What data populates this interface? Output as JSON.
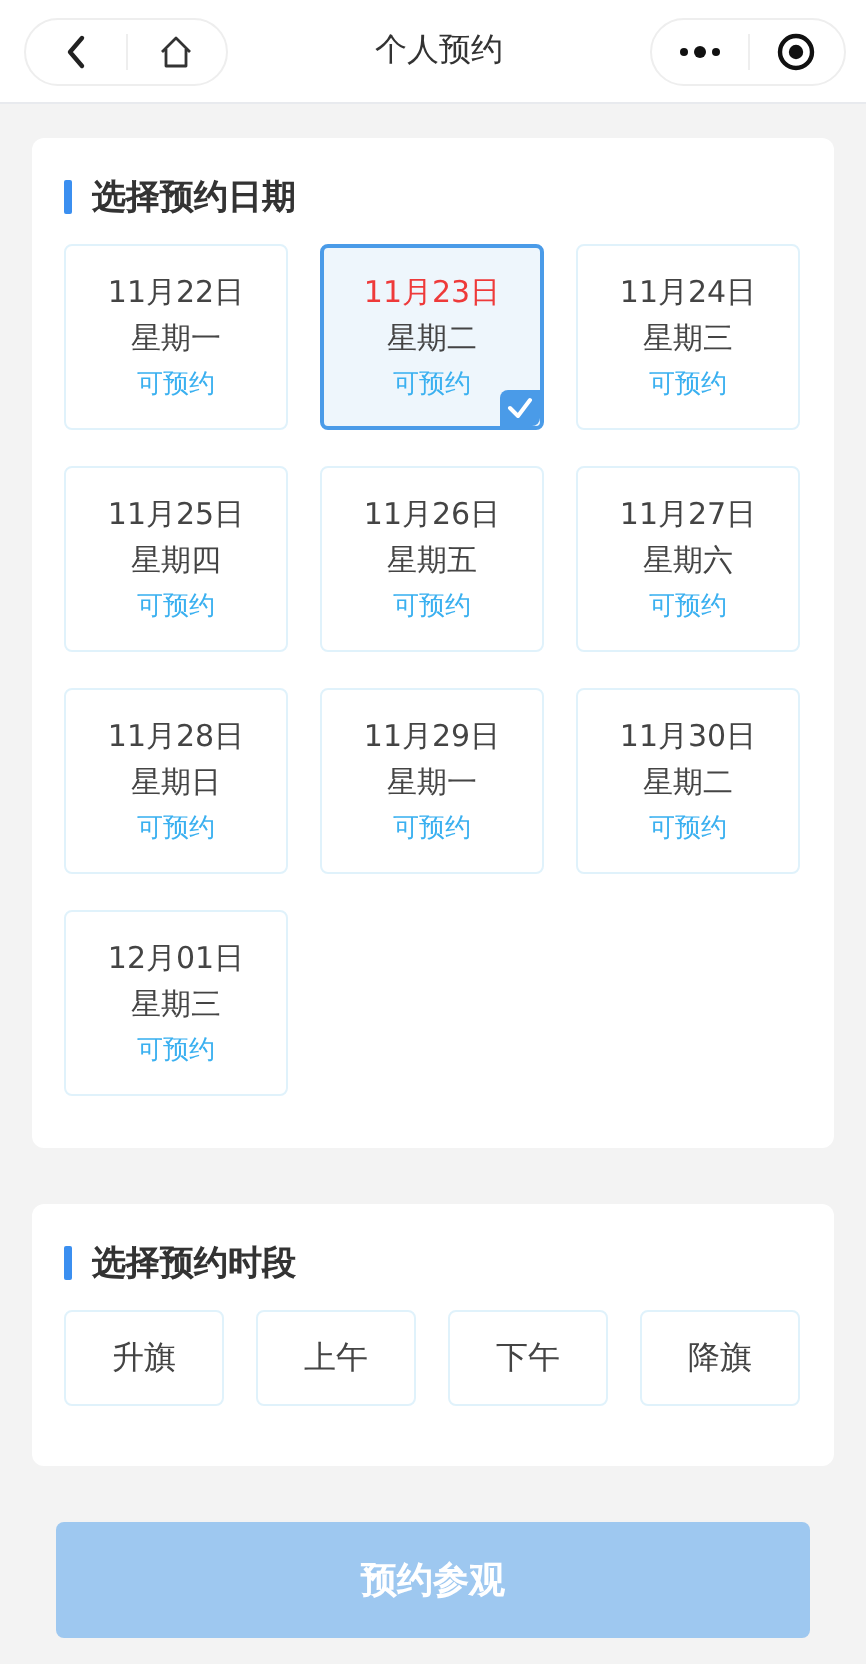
{
  "nav": {
    "title": "个人预约"
  },
  "date_section": {
    "title": "选择预约日期",
    "dates": [
      {
        "date": "11月22日",
        "weekday": "星期一",
        "status": "可预约",
        "selected": false
      },
      {
        "date": "11月23日",
        "weekday": "星期二",
        "status": "可预约",
        "selected": true
      },
      {
        "date": "11月24日",
        "weekday": "星期三",
        "status": "可预约",
        "selected": false
      },
      {
        "date": "11月25日",
        "weekday": "星期四",
        "status": "可预约",
        "selected": false
      },
      {
        "date": "11月26日",
        "weekday": "星期五",
        "status": "可预约",
        "selected": false
      },
      {
        "date": "11月27日",
        "weekday": "星期六",
        "status": "可预约",
        "selected": false
      },
      {
        "date": "11月28日",
        "weekday": "星期日",
        "status": "可预约",
        "selected": false
      },
      {
        "date": "11月29日",
        "weekday": "星期一",
        "status": "可预约",
        "selected": false
      },
      {
        "date": "11月30日",
        "weekday": "星期二",
        "status": "可预约",
        "selected": false
      },
      {
        "date": "12月01日",
        "weekday": "星期三",
        "status": "可预约",
        "selected": false
      }
    ]
  },
  "time_section": {
    "title": "选择预约时段",
    "slots": [
      {
        "label": "升旗",
        "selected": false
      },
      {
        "label": "上午",
        "selected": false
      },
      {
        "label": "下午",
        "selected": false
      },
      {
        "label": "降旗",
        "selected": false
      }
    ]
  },
  "submit": {
    "label": "预约参观",
    "disabled": true
  }
}
